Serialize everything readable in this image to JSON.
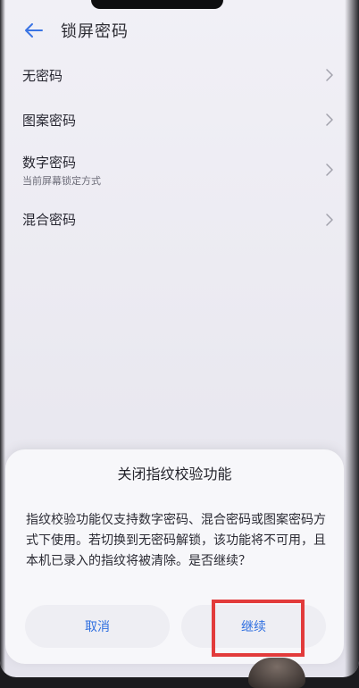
{
  "header": {
    "title": "锁屏密码"
  },
  "options": [
    {
      "label": "无密码",
      "sub": ""
    },
    {
      "label": "图案密码",
      "sub": ""
    },
    {
      "label": "数字密码",
      "sub": "当前屏幕锁定方式"
    },
    {
      "label": "混合密码",
      "sub": ""
    }
  ],
  "dialog": {
    "title": "关闭指纹校验功能",
    "message": "指纹校验功能仅支持数字密码、混合密码或图案密码方式下使用。若切换到无密码解锁，该功能将不可用，且本机已录入的指纹将被清除。是否继续？",
    "cancel_label": "取消",
    "continue_label": "继续"
  },
  "colors": {
    "accent": "#2f6fe0",
    "highlight": "#e23b3b"
  }
}
